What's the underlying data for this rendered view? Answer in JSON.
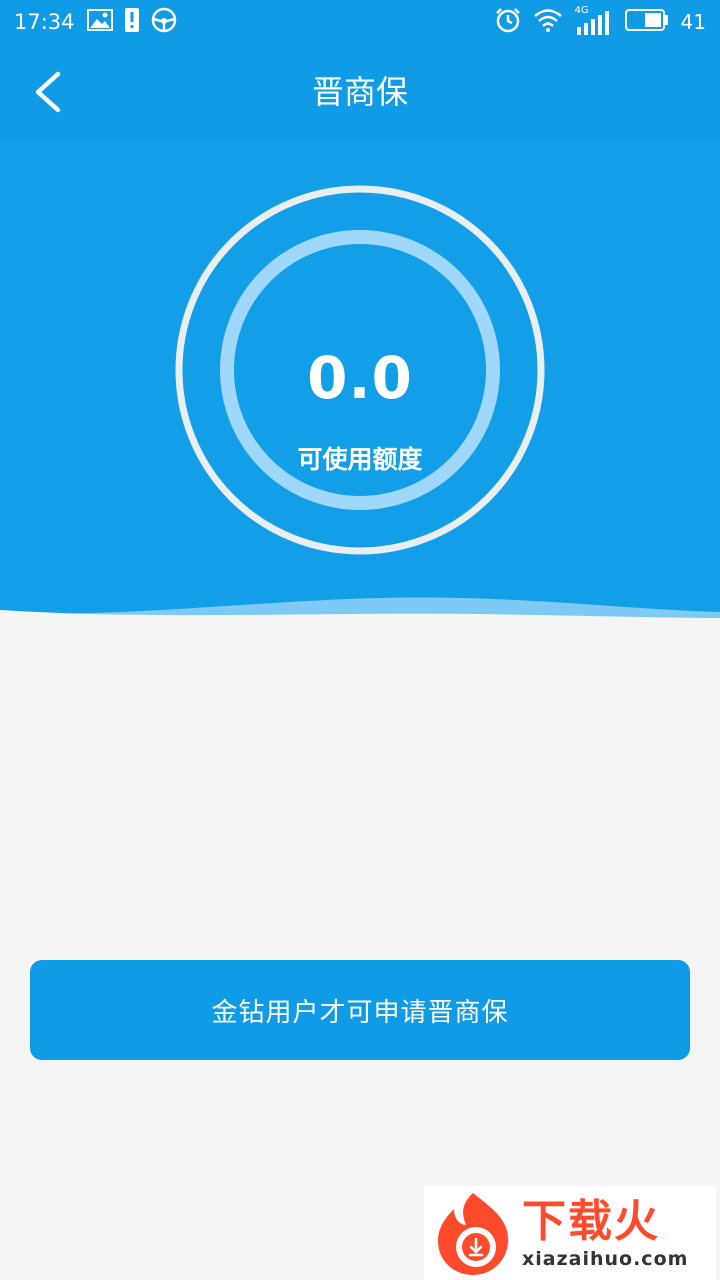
{
  "status_bar": {
    "time": "17:34",
    "battery_level": "41",
    "network_label": "4G",
    "icons": [
      "image-icon",
      "alert-icon",
      "steering-wheel-icon",
      "alarm-icon",
      "wifi-icon",
      "signal-icon",
      "battery-icon"
    ]
  },
  "header": {
    "title": "晋商保",
    "back_icon": "back-chevron-icon"
  },
  "credit": {
    "value": "0.0",
    "label": "可使用额度"
  },
  "apply_button": {
    "label": "金钻用户才可申请晋商保"
  },
  "watermark": {
    "name": "下载火",
    "domain": "xiazaihuo.com"
  },
  "colors": {
    "primary": "#0f9be6",
    "hero": "#139fe8",
    "background": "#f5f5f5",
    "ring_outer": "#e8eef2",
    "ring_inner": "#9fd8fb",
    "watermark_accent": "#ff4b2b"
  }
}
